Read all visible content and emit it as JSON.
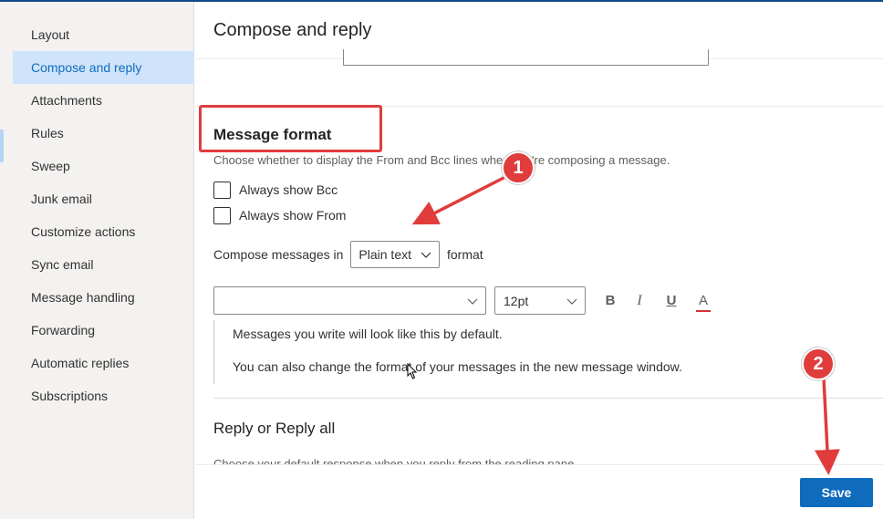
{
  "sidebar": {
    "items": [
      {
        "label": "Layout",
        "active": false
      },
      {
        "label": "Compose and reply",
        "active": true
      },
      {
        "label": "Attachments",
        "active": false
      },
      {
        "label": "Rules",
        "active": false
      },
      {
        "label": "Sweep",
        "active": false
      },
      {
        "label": "Junk email",
        "active": false
      },
      {
        "label": "Customize actions",
        "active": false
      },
      {
        "label": "Sync email",
        "active": false
      },
      {
        "label": "Message handling",
        "active": false
      },
      {
        "label": "Forwarding",
        "active": false
      },
      {
        "label": "Automatic replies",
        "active": false
      },
      {
        "label": "Subscriptions",
        "active": false
      }
    ]
  },
  "main": {
    "title": "Compose and reply",
    "message_format": {
      "title": "Message format",
      "description": "Choose whether to display the From and Bcc lines when you're composing a message.",
      "always_show_bcc": {
        "label": "Always show Bcc",
        "checked": false
      },
      "always_show_from": {
        "label": "Always show From",
        "checked": false
      },
      "compose_prefix": "Compose messages in",
      "compose_format_value": "Plain text",
      "compose_suffix": "format",
      "font_value": "",
      "size_value": "12pt",
      "toolbar": {
        "bold": "B",
        "italic": "I",
        "underline": "U",
        "font_color": "A"
      },
      "preview_line1": "Messages you write will look like this by default.",
      "preview_line2": "You can also change the format of your messages in the new message window."
    },
    "reply": {
      "title": "Reply or Reply all",
      "description": "Choose your default response when you reply from the reading pane."
    },
    "save_label": "Save"
  },
  "annotations": {
    "badge1": "1",
    "badge2": "2"
  },
  "colors": {
    "accent": "#0f6cbd",
    "active_nav_bg": "#cfe4fa",
    "annotation_red": "#e03c3c"
  }
}
